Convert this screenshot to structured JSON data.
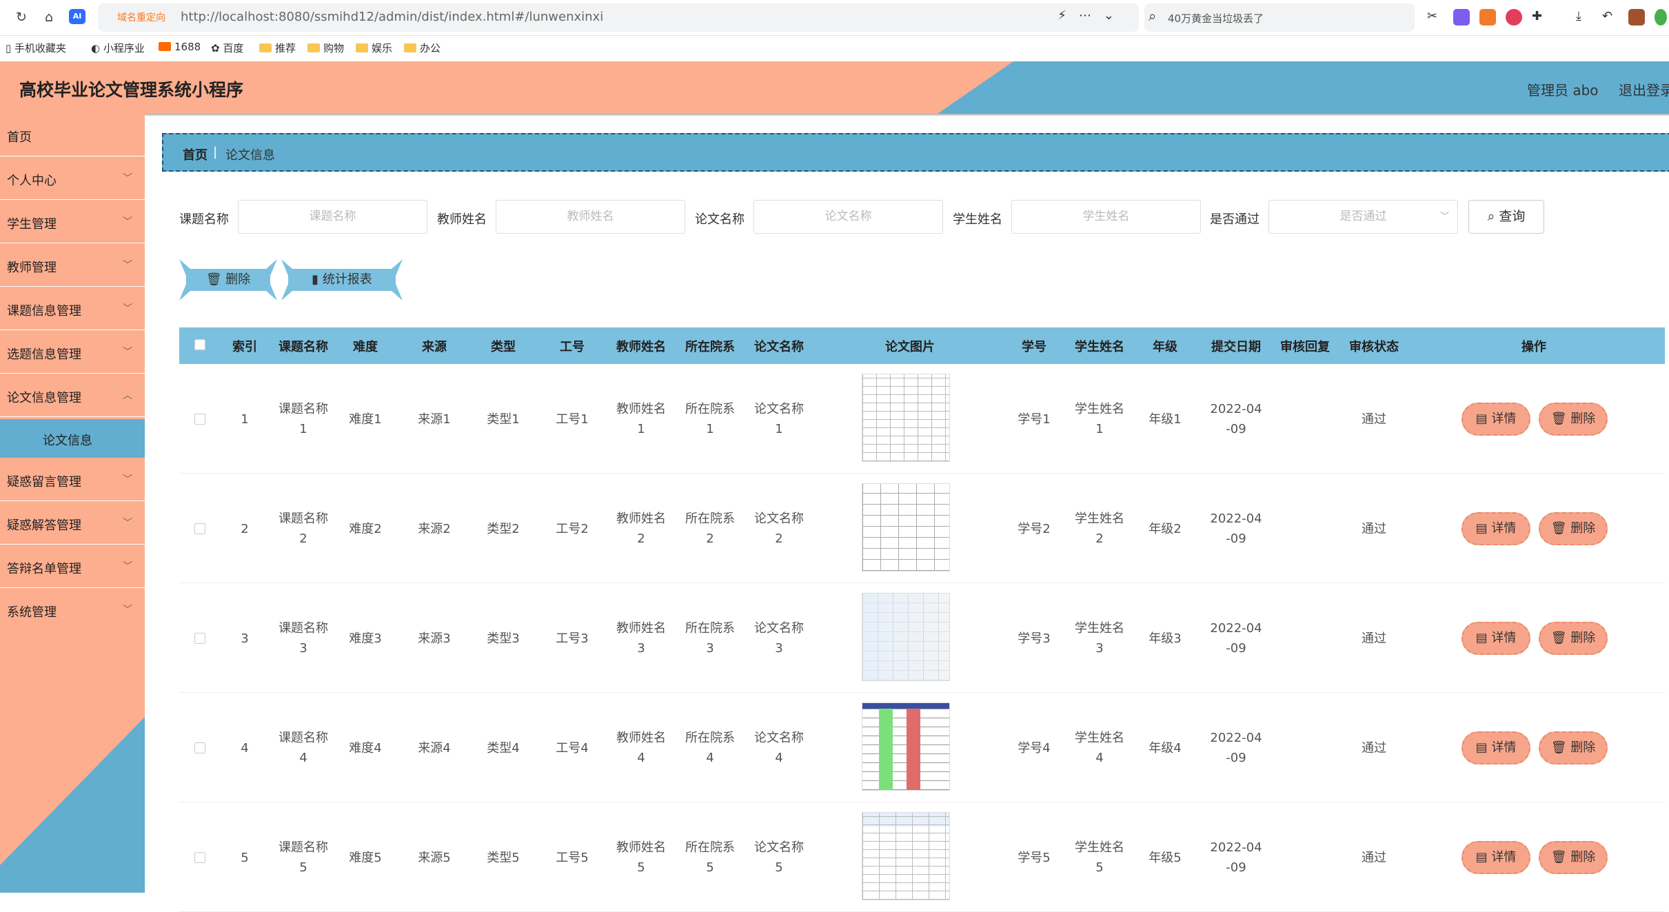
{
  "browser": {
    "redirect_label": "域名重定向",
    "url": "http://localhost:8080/ssmihd12/admin/dist/index.html#/lunwenxinxi",
    "search_text": "40万黄金当垃圾丢了",
    "bookmarks": [
      "手机收藏夹",
      "小程序业",
      "1688",
      "百度",
      "推荐",
      "购物",
      "娱乐",
      "办公"
    ]
  },
  "header": {
    "title": "高校毕业论文管理系统小程序",
    "user": "管理员 abo",
    "logout": "退出登录"
  },
  "sidebar": {
    "items": [
      {
        "label": "首页"
      },
      {
        "label": "个人中心"
      },
      {
        "label": "学生管理"
      },
      {
        "label": "教师管理"
      },
      {
        "label": "课题信息管理"
      },
      {
        "label": "选题信息管理"
      },
      {
        "label": "论文信息管理"
      },
      {
        "label": "论文信息"
      },
      {
        "label": "疑惑留言管理"
      },
      {
        "label": "疑惑解答管理"
      },
      {
        "label": "答辩名单管理"
      },
      {
        "label": "系统管理"
      }
    ]
  },
  "breadcrumb": {
    "home": "首页",
    "sep": "|",
    "current": "论文信息"
  },
  "filters": {
    "topic_label": "课题名称",
    "topic_placeholder": "课题名称",
    "teacher_label": "教师姓名",
    "teacher_placeholder": "教师姓名",
    "paper_label": "论文名称",
    "paper_placeholder": "论文名称",
    "student_label": "学生姓名",
    "student_placeholder": "学生姓名",
    "pass_label": "是否通过",
    "pass_placeholder": "是否通过",
    "query_label": "查询"
  },
  "actions": {
    "delete_label": "删除",
    "report_label": "统计报表"
  },
  "table": {
    "columns": [
      "索引",
      "课题名称",
      "难度",
      "来源",
      "类型",
      "工号",
      "教师姓名",
      "所在院系",
      "论文名称",
      "论文图片",
      "学号",
      "学生姓名",
      "年级",
      "提交日期",
      "审核回复",
      "审核状态",
      "操作"
    ],
    "detail_label": "详情",
    "delete_label": "删除",
    "rows": [
      {
        "index": "1",
        "topic": [
          "课题名称",
          "1"
        ],
        "difficulty": "难度1",
        "source": "来源1",
        "type": "类型1",
        "job_no": "工号1",
        "teacher": [
          "教师姓名",
          "1"
        ],
        "dept": [
          "所在院系",
          "1"
        ],
        "paper": [
          "论文名称",
          "1"
        ],
        "student_no": "学号1",
        "student": [
          "学生姓名",
          "1"
        ],
        "grade": "年级1",
        "date": [
          "2022-04",
          "-09"
        ],
        "reply": "",
        "status": "通过"
      },
      {
        "index": "2",
        "topic": [
          "课题名称",
          "2"
        ],
        "difficulty": "难度2",
        "source": "来源2",
        "type": "类型2",
        "job_no": "工号2",
        "teacher": [
          "教师姓名",
          "2"
        ],
        "dept": [
          "所在院系",
          "2"
        ],
        "paper": [
          "论文名称",
          "2"
        ],
        "student_no": "学号2",
        "student": [
          "学生姓名",
          "2"
        ],
        "grade": "年级2",
        "date": [
          "2022-04",
          "-09"
        ],
        "reply": "",
        "status": "通过"
      },
      {
        "index": "3",
        "topic": [
          "课题名称",
          "3"
        ],
        "difficulty": "难度3",
        "source": "来源3",
        "type": "类型3",
        "job_no": "工号3",
        "teacher": [
          "教师姓名",
          "3"
        ],
        "dept": [
          "所在院系",
          "3"
        ],
        "paper": [
          "论文名称",
          "3"
        ],
        "student_no": "学号3",
        "student": [
          "学生姓名",
          "3"
        ],
        "grade": "年级3",
        "date": [
          "2022-04",
          "-09"
        ],
        "reply": "",
        "status": "通过"
      },
      {
        "index": "4",
        "topic": [
          "课题名称",
          "4"
        ],
        "difficulty": "难度4",
        "source": "来源4",
        "type": "类型4",
        "job_no": "工号4",
        "teacher": [
          "教师姓名",
          "4"
        ],
        "dept": [
          "所在院系",
          "4"
        ],
        "paper": [
          "论文名称",
          "4"
        ],
        "student_no": "学号4",
        "student": [
          "学生姓名",
          "4"
        ],
        "grade": "年级4",
        "date": [
          "2022-04",
          "-09"
        ],
        "reply": "",
        "status": "通过"
      },
      {
        "index": "5",
        "topic": [
          "课题名称",
          "5"
        ],
        "difficulty": "难度5",
        "source": "来源5",
        "type": "类型5",
        "job_no": "工号5",
        "teacher": [
          "教师姓名",
          "5"
        ],
        "dept": [
          "所在院系",
          "5"
        ],
        "paper": [
          "论文名称",
          "5"
        ],
        "student_no": "学号5",
        "student": [
          "学生姓名",
          "5"
        ],
        "grade": "年级5",
        "date": [
          "2022-04",
          "-09"
        ],
        "reply": "",
        "status": "通过"
      }
    ]
  },
  "colors": {
    "header_peach": "#fdae8f",
    "accent_blue": "#62aed0",
    "table_head": "#7cc0df",
    "pill_button": "#f7a58a"
  }
}
